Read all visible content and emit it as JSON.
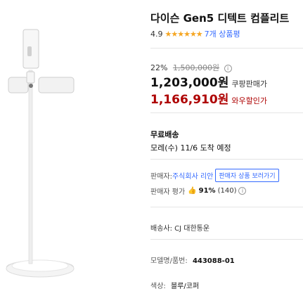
{
  "product": {
    "title": "다이슨 Gen5 디텍트 컴플리트",
    "image_alt": "product-floor-stand-image"
  },
  "rating": {
    "score": "4.9",
    "stars": "★★★★★★",
    "review_count": "7개 상품평"
  },
  "pricing": {
    "discount_rate": "22%",
    "original_price": "1,500,000원",
    "info_glyph": "i",
    "coupang_price": "1,203,000원",
    "coupang_label": "쿠팡판매가",
    "wow_price": "1,166,910원",
    "wow_label": "와우할인가"
  },
  "shipping": {
    "title": "무료배송",
    "arrival": "모레(수) 11/6 도착 예정"
  },
  "seller": {
    "label": "판매자:",
    "name": "주식회사 리안",
    "more_button": "판매자 상품 보러가기",
    "eval_label": "판매자 평가",
    "thumb_glyph": "👍",
    "eval_percent": "91%",
    "eval_count": "(140)",
    "info_glyph": "i"
  },
  "delivery": {
    "carrier": "배송사: CJ 대한통운"
  },
  "details": {
    "model_label": "모델명/품번:",
    "model_value": "443088-01",
    "color_label": "색상:",
    "color_value": "블루/코퍼"
  },
  "colors": {
    "accent_blue": "#346aff",
    "wow_red": "#ae0000",
    "star": "#f5a623"
  }
}
